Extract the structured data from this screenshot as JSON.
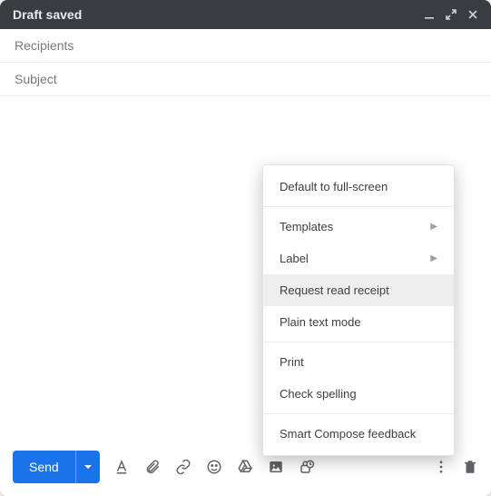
{
  "header": {
    "title": "Draft saved"
  },
  "fields": {
    "recipients_placeholder": "Recipients",
    "subject_placeholder": "Subject"
  },
  "send": {
    "label": "Send"
  },
  "menu": {
    "default_fullscreen": "Default to full-screen",
    "templates": "Templates",
    "label": "Label",
    "request_read_receipt": "Request read receipt",
    "plain_text": "Plain text mode",
    "print": "Print",
    "check_spelling": "Check spelling",
    "smart_compose": "Smart Compose feedback"
  }
}
